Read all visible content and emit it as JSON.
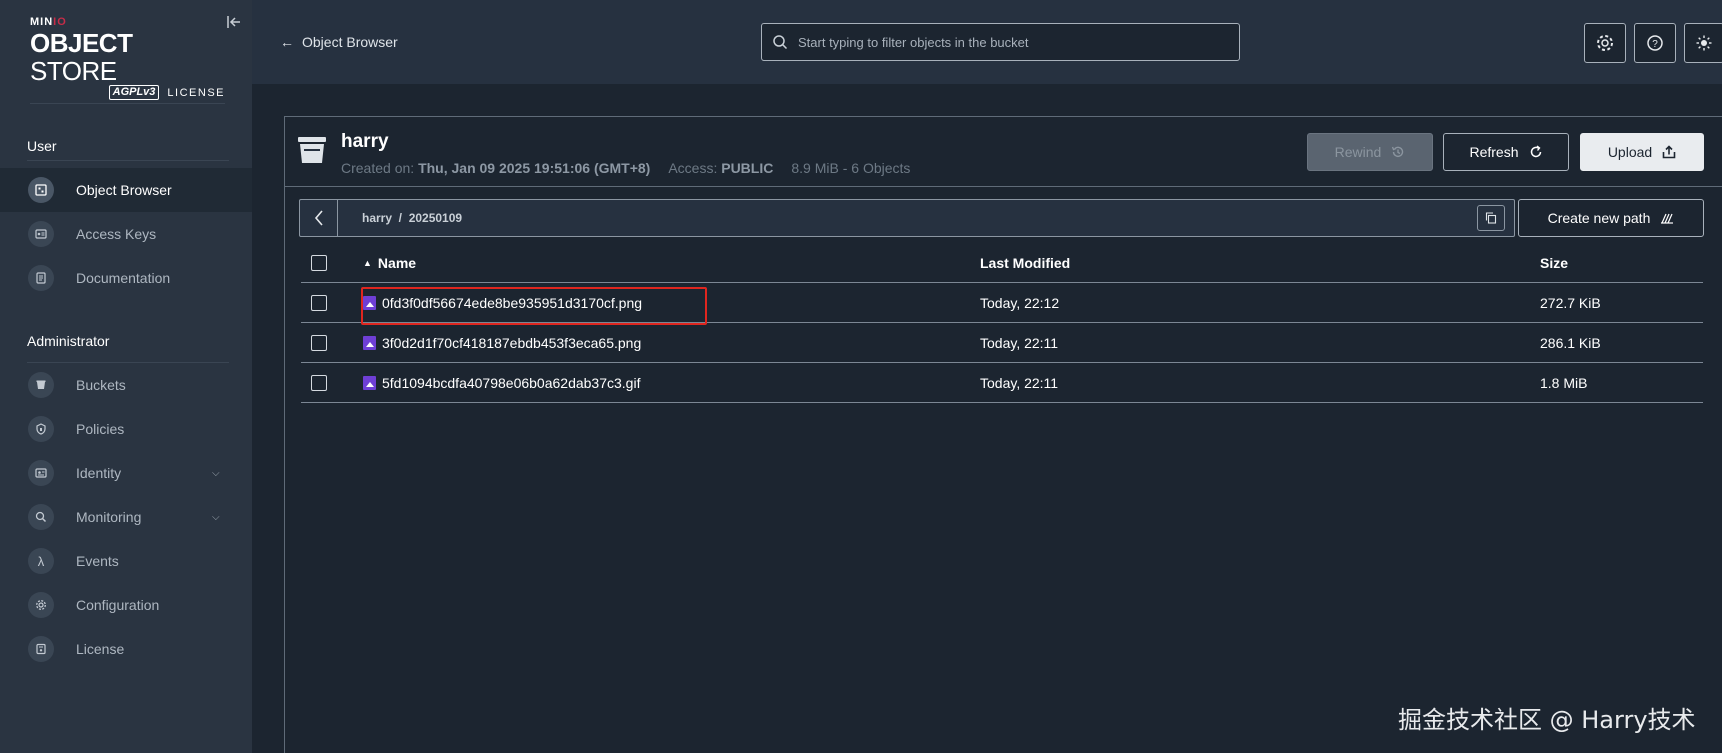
{
  "sidebar": {
    "logo": {
      "minio_a": "MIN",
      "minio_b": "IO",
      "main_a": "OBJECT",
      "main_b": " STORE",
      "agpl": "AGPLv3",
      "license": "LICENSE"
    },
    "sections": [
      {
        "title": "User",
        "items": [
          {
            "label": "Object Browser",
            "icon": "object-browser-icon",
            "active": true
          },
          {
            "label": "Access Keys",
            "icon": "access-keys-icon",
            "active": false
          },
          {
            "label": "Documentation",
            "icon": "documentation-icon",
            "active": false
          }
        ]
      },
      {
        "title": "Administrator",
        "items": [
          {
            "label": "Buckets",
            "icon": "buckets-icon",
            "active": false
          },
          {
            "label": "Policies",
            "icon": "policies-icon",
            "active": false
          },
          {
            "label": "Identity",
            "icon": "identity-icon",
            "active": false,
            "expandable": true
          },
          {
            "label": "Monitoring",
            "icon": "monitoring-icon",
            "active": false,
            "expandable": true
          },
          {
            "label": "Events",
            "icon": "lambda-icon",
            "active": false
          },
          {
            "label": "Configuration",
            "icon": "configuration-icon",
            "active": false
          },
          {
            "label": "License",
            "icon": "license-icon",
            "active": false
          }
        ]
      }
    ]
  },
  "topbar": {
    "back_label": "Object Browser",
    "search_placeholder": "Start typing to filter objects in the bucket",
    "buttons": [
      "gear-icon",
      "help-icon",
      "theme-icon"
    ]
  },
  "bucket": {
    "name": "harry",
    "created_label": "Created on:",
    "created_value": "Thu, Jan 09 2025 19:51:06 (GMT+8)",
    "access_label": "Access:",
    "access_value": "PUBLIC",
    "summary": "8.9 MiB - 6 Objects",
    "rewind_label": "Rewind",
    "refresh_label": "Refresh",
    "upload_label": "Upload"
  },
  "path": {
    "text": "harry  /  20250109",
    "new_path_label": "Create new path"
  },
  "table": {
    "columns": {
      "name": "Name",
      "modified": "Last Modified",
      "size": "Size"
    },
    "rows": [
      {
        "name": "0fd3f0df56674ede8be935951d3170cf.png",
        "modified": "Today, 22:12",
        "size": "272.7 KiB",
        "highlighted": true
      },
      {
        "name": "3f0d2d1f70cf418187ebdb453f3eca65.png",
        "modified": "Today, 22:11",
        "size": "286.1 KiB",
        "highlighted": false
      },
      {
        "name": "5fd1094bcdfa40798e06b0a62dab37c3.gif",
        "modified": "Today, 22:11",
        "size": "1.8 MiB",
        "highlighted": false
      }
    ]
  },
  "watermark": "掘金技术社区 @ Harry技术",
  "colors": {
    "sidebar": "#2a3441",
    "background": "#1c2530",
    "topbar": "#263140",
    "file_icon": "#6f3fd6",
    "highlight": "#e0261f"
  }
}
